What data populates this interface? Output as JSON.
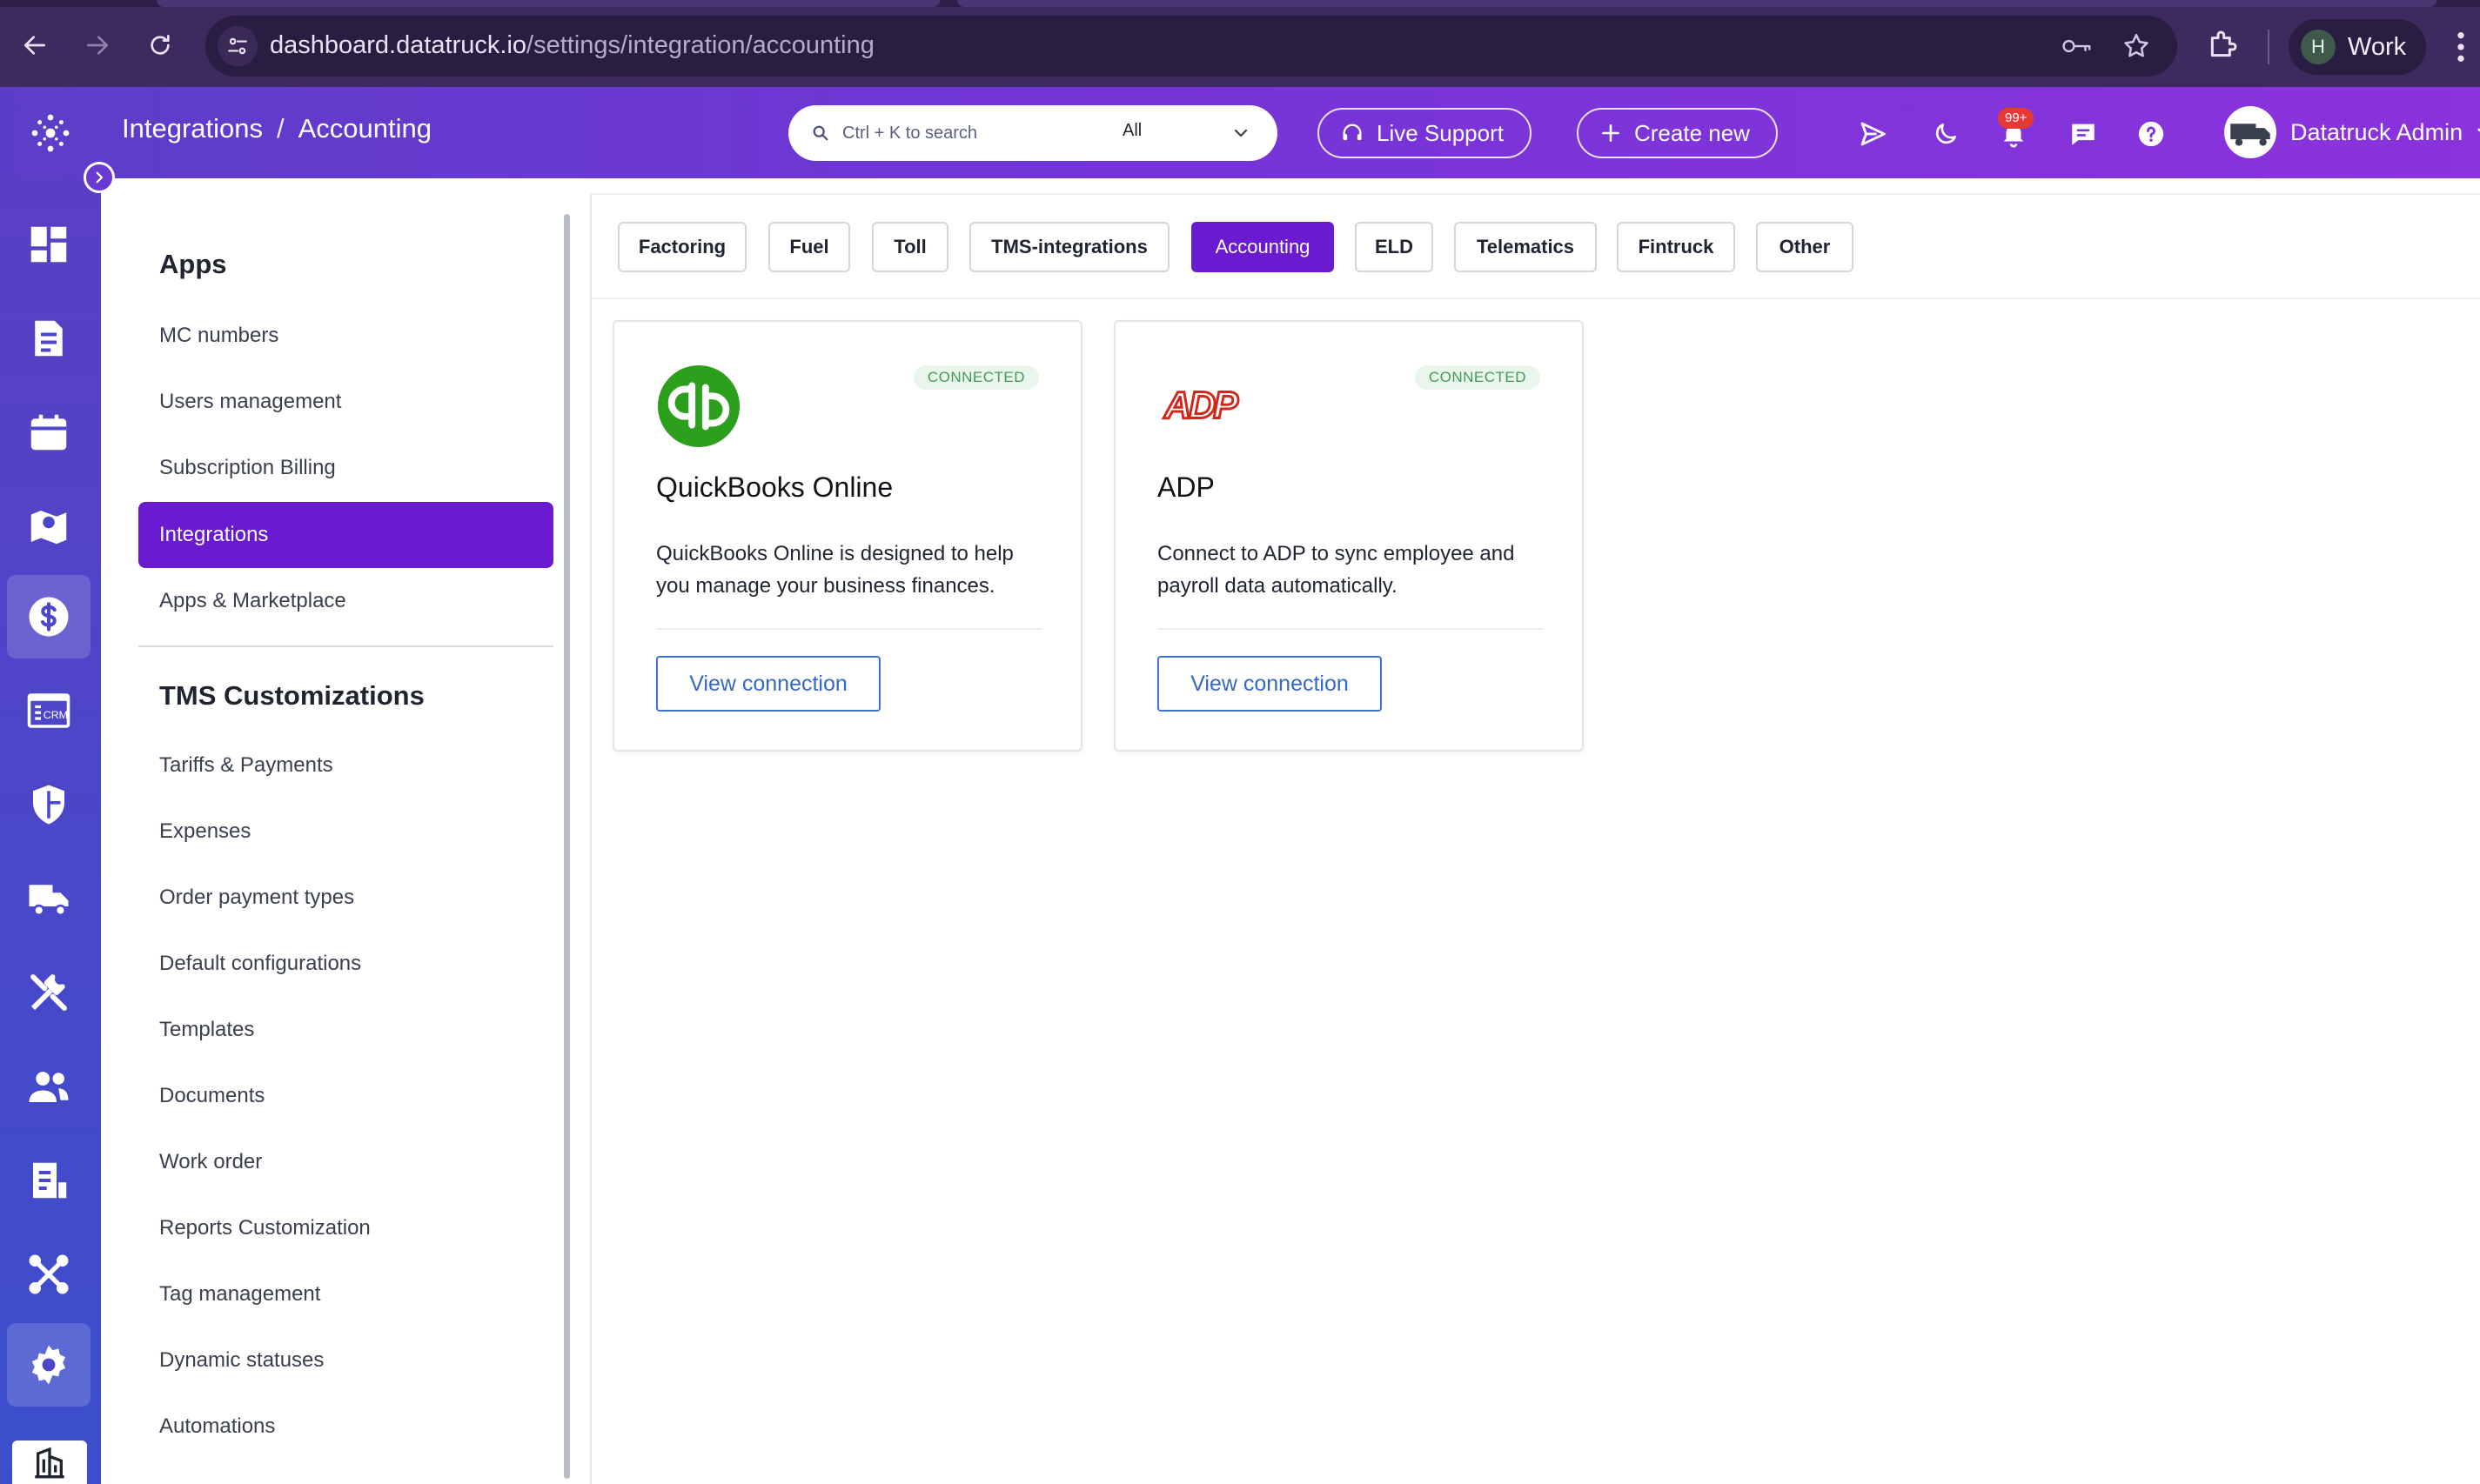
{
  "browser": {
    "url_host": "dashboard.datatruck.io",
    "url_path": "/settings/integration/accounting",
    "profile_initial": "H",
    "profile_name": "Work"
  },
  "header": {
    "breadcrumb": [
      "Integrations",
      "/",
      "Accounting"
    ],
    "search": {
      "placeholder": "Ctrl + K to search",
      "scope": "All"
    },
    "live_support_label": "Live Support",
    "create_new_label": "Create new",
    "notification_count": "99+",
    "user_name": "Datatruck Admin"
  },
  "rail": {
    "items": [
      {
        "icon": "dashboard-icon"
      },
      {
        "icon": "orders-icon"
      },
      {
        "icon": "calendar-icon"
      },
      {
        "icon": "map-pin-icon"
      },
      {
        "icon": "dollar-icon",
        "active": true
      },
      {
        "icon": "crm-icon",
        "label": "CRM"
      },
      {
        "icon": "shield-icon"
      },
      {
        "icon": "truck-icon"
      },
      {
        "icon": "tools-icon"
      },
      {
        "icon": "users-icon"
      },
      {
        "icon": "reports-icon"
      },
      {
        "icon": "network-icon"
      },
      {
        "icon": "gear-icon",
        "active": true
      },
      {
        "icon": "building-icon"
      }
    ]
  },
  "settings_menu": {
    "section1_title": "Apps",
    "section1_items": [
      "MC numbers",
      "Users management",
      "Subscription Billing",
      "Integrations",
      "Apps & Marketplace"
    ],
    "active_item": "Integrations",
    "section2_title": "TMS Customizations",
    "section2_items": [
      "Tariffs & Payments",
      "Expenses",
      "Order payment types",
      "Default configurations",
      "Templates",
      "Documents",
      "Work order",
      "Reports Customization",
      "Tag management",
      "Dynamic statuses",
      "Automations"
    ]
  },
  "tabs": {
    "items": [
      "Factoring",
      "Fuel",
      "Toll",
      "TMS-integrations",
      "Accounting",
      "ELD",
      "Telematics",
      "Fintruck",
      "Other"
    ],
    "active": "Accounting"
  },
  "cards": [
    {
      "title": "QuickBooks Online",
      "status": "CONNECTED",
      "description": "QuickBooks Online is designed to help you manage your business finances.",
      "button_label": "View connection",
      "logo_text": "qb",
      "logo_color": "#2ca01c"
    },
    {
      "title": "ADP",
      "status": "CONNECTED",
      "description": "Connect to ADP to sync employee and payroll data automatically.",
      "button_label": "View connection",
      "logo_text": "ADP",
      "logo_color": "#d0271d"
    }
  ],
  "colors": {
    "accent": "#6a1ad1",
    "header_gradient_start": "#5b3ec8",
    "header_gradient_end": "#8b33dc",
    "connected_green": "#3f9a54",
    "link_blue": "#3369c4"
  }
}
